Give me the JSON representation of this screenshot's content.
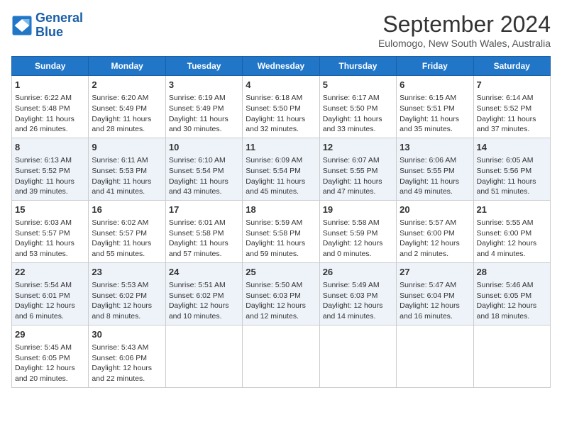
{
  "header": {
    "logo_line1": "General",
    "logo_line2": "Blue",
    "month": "September 2024",
    "location": "Eulomogo, New South Wales, Australia"
  },
  "weekdays": [
    "Sunday",
    "Monday",
    "Tuesday",
    "Wednesday",
    "Thursday",
    "Friday",
    "Saturday"
  ],
  "weeks": [
    [
      {
        "day": "1",
        "lines": [
          "Sunrise: 6:22 AM",
          "Sunset: 5:48 PM",
          "Daylight: 11 hours",
          "and 26 minutes."
        ]
      },
      {
        "day": "2",
        "lines": [
          "Sunrise: 6:20 AM",
          "Sunset: 5:49 PM",
          "Daylight: 11 hours",
          "and 28 minutes."
        ]
      },
      {
        "day": "3",
        "lines": [
          "Sunrise: 6:19 AM",
          "Sunset: 5:49 PM",
          "Daylight: 11 hours",
          "and 30 minutes."
        ]
      },
      {
        "day": "4",
        "lines": [
          "Sunrise: 6:18 AM",
          "Sunset: 5:50 PM",
          "Daylight: 11 hours",
          "and 32 minutes."
        ]
      },
      {
        "day": "5",
        "lines": [
          "Sunrise: 6:17 AM",
          "Sunset: 5:50 PM",
          "Daylight: 11 hours",
          "and 33 minutes."
        ]
      },
      {
        "day": "6",
        "lines": [
          "Sunrise: 6:15 AM",
          "Sunset: 5:51 PM",
          "Daylight: 11 hours",
          "and 35 minutes."
        ]
      },
      {
        "day": "7",
        "lines": [
          "Sunrise: 6:14 AM",
          "Sunset: 5:52 PM",
          "Daylight: 11 hours",
          "and 37 minutes."
        ]
      }
    ],
    [
      {
        "day": "8",
        "lines": [
          "Sunrise: 6:13 AM",
          "Sunset: 5:52 PM",
          "Daylight: 11 hours",
          "and 39 minutes."
        ]
      },
      {
        "day": "9",
        "lines": [
          "Sunrise: 6:11 AM",
          "Sunset: 5:53 PM",
          "Daylight: 11 hours",
          "and 41 minutes."
        ]
      },
      {
        "day": "10",
        "lines": [
          "Sunrise: 6:10 AM",
          "Sunset: 5:54 PM",
          "Daylight: 11 hours",
          "and 43 minutes."
        ]
      },
      {
        "day": "11",
        "lines": [
          "Sunrise: 6:09 AM",
          "Sunset: 5:54 PM",
          "Daylight: 11 hours",
          "and 45 minutes."
        ]
      },
      {
        "day": "12",
        "lines": [
          "Sunrise: 6:07 AM",
          "Sunset: 5:55 PM",
          "Daylight: 11 hours",
          "and 47 minutes."
        ]
      },
      {
        "day": "13",
        "lines": [
          "Sunrise: 6:06 AM",
          "Sunset: 5:55 PM",
          "Daylight: 11 hours",
          "and 49 minutes."
        ]
      },
      {
        "day": "14",
        "lines": [
          "Sunrise: 6:05 AM",
          "Sunset: 5:56 PM",
          "Daylight: 11 hours",
          "and 51 minutes."
        ]
      }
    ],
    [
      {
        "day": "15",
        "lines": [
          "Sunrise: 6:03 AM",
          "Sunset: 5:57 PM",
          "Daylight: 11 hours",
          "and 53 minutes."
        ]
      },
      {
        "day": "16",
        "lines": [
          "Sunrise: 6:02 AM",
          "Sunset: 5:57 PM",
          "Daylight: 11 hours",
          "and 55 minutes."
        ]
      },
      {
        "day": "17",
        "lines": [
          "Sunrise: 6:01 AM",
          "Sunset: 5:58 PM",
          "Daylight: 11 hours",
          "and 57 minutes."
        ]
      },
      {
        "day": "18",
        "lines": [
          "Sunrise: 5:59 AM",
          "Sunset: 5:58 PM",
          "Daylight: 11 hours",
          "and 59 minutes."
        ]
      },
      {
        "day": "19",
        "lines": [
          "Sunrise: 5:58 AM",
          "Sunset: 5:59 PM",
          "Daylight: 12 hours",
          "and 0 minutes."
        ]
      },
      {
        "day": "20",
        "lines": [
          "Sunrise: 5:57 AM",
          "Sunset: 6:00 PM",
          "Daylight: 12 hours",
          "and 2 minutes."
        ]
      },
      {
        "day": "21",
        "lines": [
          "Sunrise: 5:55 AM",
          "Sunset: 6:00 PM",
          "Daylight: 12 hours",
          "and 4 minutes."
        ]
      }
    ],
    [
      {
        "day": "22",
        "lines": [
          "Sunrise: 5:54 AM",
          "Sunset: 6:01 PM",
          "Daylight: 12 hours",
          "and 6 minutes."
        ]
      },
      {
        "day": "23",
        "lines": [
          "Sunrise: 5:53 AM",
          "Sunset: 6:02 PM",
          "Daylight: 12 hours",
          "and 8 minutes."
        ]
      },
      {
        "day": "24",
        "lines": [
          "Sunrise: 5:51 AM",
          "Sunset: 6:02 PM",
          "Daylight: 12 hours",
          "and 10 minutes."
        ]
      },
      {
        "day": "25",
        "lines": [
          "Sunrise: 5:50 AM",
          "Sunset: 6:03 PM",
          "Daylight: 12 hours",
          "and 12 minutes."
        ]
      },
      {
        "day": "26",
        "lines": [
          "Sunrise: 5:49 AM",
          "Sunset: 6:03 PM",
          "Daylight: 12 hours",
          "and 14 minutes."
        ]
      },
      {
        "day": "27",
        "lines": [
          "Sunrise: 5:47 AM",
          "Sunset: 6:04 PM",
          "Daylight: 12 hours",
          "and 16 minutes."
        ]
      },
      {
        "day": "28",
        "lines": [
          "Sunrise: 5:46 AM",
          "Sunset: 6:05 PM",
          "Daylight: 12 hours",
          "and 18 minutes."
        ]
      }
    ],
    [
      {
        "day": "29",
        "lines": [
          "Sunrise: 5:45 AM",
          "Sunset: 6:05 PM",
          "Daylight: 12 hours",
          "and 20 minutes."
        ]
      },
      {
        "day": "30",
        "lines": [
          "Sunrise: 5:43 AM",
          "Sunset: 6:06 PM",
          "Daylight: 12 hours",
          "and 22 minutes."
        ]
      },
      {
        "day": "",
        "lines": []
      },
      {
        "day": "",
        "lines": []
      },
      {
        "day": "",
        "lines": []
      },
      {
        "day": "",
        "lines": []
      },
      {
        "day": "",
        "lines": []
      }
    ]
  ]
}
